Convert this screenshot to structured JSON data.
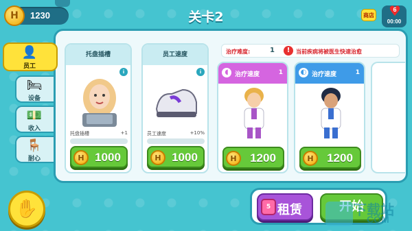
{
  "top": {
    "coins": "1230",
    "coin_symbol": "H",
    "title": "关卡2",
    "help_label": "商店",
    "lives": "6",
    "timer": "00:00"
  },
  "tabs": [
    {
      "label": "员工",
      "icon": "staff-icon",
      "active": true
    },
    {
      "label": "设备",
      "icon": "equipment-icon"
    },
    {
      "label": "收入",
      "icon": "money-icon"
    },
    {
      "label": "耐心",
      "icon": "patience-icon"
    }
  ],
  "disease": {
    "difficulty_label": "治疗难度:",
    "difficulty_value": "1",
    "notice": "当前疾病将被医生快速治愈"
  },
  "cards": [
    {
      "title": "托盘插槽",
      "stat_label": "托盘插槽",
      "stat_value": "+1",
      "price": "1000",
      "progress": 0
    },
    {
      "title": "员工速度",
      "stat_label": "员工速度",
      "stat_value": "+10%",
      "price": "1000",
      "progress": 0
    }
  ],
  "doctors": [
    {
      "title": "治疗速度",
      "level": "1",
      "price": "1200",
      "color": "#d565e0"
    },
    {
      "title": "治疗速度",
      "level": "1",
      "price": "1200",
      "color": "#3e9be8"
    }
  ],
  "bottom": {
    "rent_label": "租赁",
    "rent_badge": "5",
    "start_label": "开始"
  },
  "watermark": {
    "line1": "下载站",
    "line2": "COM"
  }
}
